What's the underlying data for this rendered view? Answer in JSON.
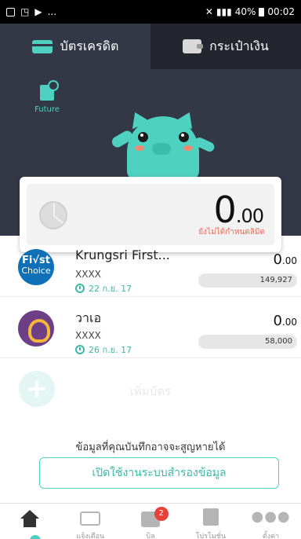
{
  "status_bar": {
    "left_icons": [
      "image-icon",
      "nfc-icon",
      "play-icon"
    ],
    "ellipsis": "...",
    "battery": "40%",
    "time": "00:02"
  },
  "tabs": [
    {
      "label": "บัตรเครดิต",
      "icon": "credit-card-icon",
      "active": true
    },
    {
      "label": "กระเป๋าเงิน",
      "icon": "wallet-icon",
      "active": false
    }
  ],
  "future": {
    "label": "Future",
    "icon": "future-bill-icon"
  },
  "balance": {
    "integer": "0",
    "decimal": ".00",
    "note": "ยังไม่ได้กำหนดลิมิต"
  },
  "cards": [
    {
      "name": "Krungsri First...",
      "logo": "first-choice-logo",
      "logo_text_top": "Fi√st",
      "logo_text_bottom": "Choice",
      "number": "XXXX",
      "due_date": "22 ก.ย. 17",
      "amount_int": "0",
      "amount_dec": ".00",
      "limit": "149,927"
    },
    {
      "name": "วาเอ",
      "logo": "bank-gold-logo",
      "number": "XXXX",
      "due_date": "26 ก.ย. 17",
      "amount_int": "0",
      "amount_dec": ".00",
      "limit": "58,000"
    }
  ],
  "add_card": {
    "label": "เพิ่มบัตร"
  },
  "backup": {
    "warning": "ข้อมูลที่คุณบันทึกอาจจะสูญหายได้",
    "button": "เปิดใช้งานระบบสำรองข้อมูล"
  },
  "bottom_nav": [
    {
      "label": "",
      "icon": "home-icon",
      "active": true
    },
    {
      "label": "แจ้งเตือน",
      "icon": "mail-icon"
    },
    {
      "label": "บิล",
      "icon": "bill-icon",
      "badge": "2"
    },
    {
      "label": "โปรโมชั่น",
      "icon": "gift-icon"
    },
    {
      "label": "ตั้งค่า",
      "icon": "more-icon"
    }
  ],
  "colors": {
    "accent": "#4fd1c1",
    "header_bg": "#333846",
    "badge": "#e8413a"
  }
}
